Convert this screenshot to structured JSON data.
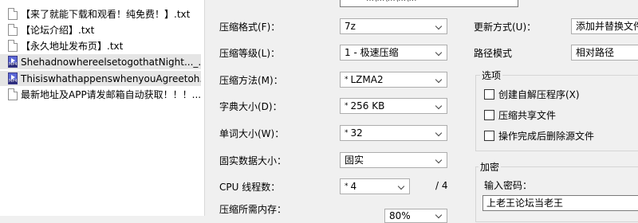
{
  "files": [
    {
      "name": "【来了就能下载和观看！纯免费！】.txt",
      "type": "txt"
    },
    {
      "name": "【论坛介绍】.txt",
      "type": "txt"
    },
    {
      "name": "【永久地址发布页】.txt",
      "type": "txt"
    },
    {
      "name": "ShehadnowhereelsetogothatNight..._...",
      "type": "mp4"
    },
    {
      "name": "ThisiswhathappenswhenyouAgreetoh...",
      "type": "mp4"
    },
    {
      "name": "最新地址及APP请发邮箱自动获取！！！...",
      "type": "txt"
    }
  ],
  "file_icon_text": "MP4",
  "archive_path_fragment": "…\\…\\…\\…\\…",
  "settings": {
    "format_label": "压缩格式(F)：",
    "format_value": "7z",
    "level_label": "压缩等级(L)：",
    "level_value": "1 - 极速压缩",
    "method_label": "压缩方法(M)：",
    "method_value": "LZMA2",
    "dict_label": "字典大小(D)：",
    "dict_value": "256 KB",
    "word_label": "单词大小(W)：",
    "word_value": "32",
    "solid_label": "固实数据大小：",
    "solid_value": "固实",
    "threads_label": "CPU 线程数：",
    "threads_value": "4",
    "threads_max": "/ 4",
    "memory_label": "压缩所需内存：",
    "memory_value": "80%"
  },
  "right": {
    "update_label": "更新方式(U)：",
    "update_value": "添加并替换文件",
    "path_label": "路径模式",
    "path_value": "相对路径",
    "options_title": "选项",
    "opt_sfx": "创建自解压程序(X)",
    "opt_shared": "压缩共享文件",
    "opt_delete": "操作完成后删除源文件",
    "encryption_title": "加密",
    "password_label": "输入密码：",
    "password_value": "上老王论坛当老王"
  },
  "star_glyph": "*"
}
